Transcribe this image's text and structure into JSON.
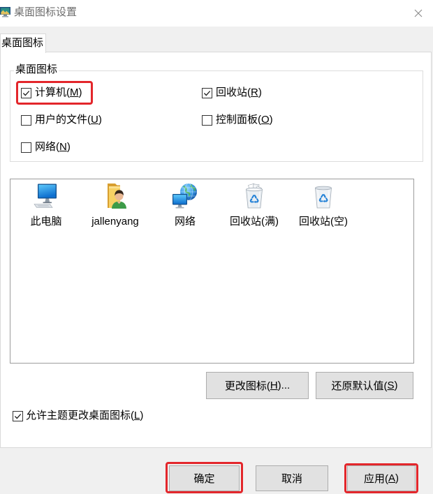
{
  "window": {
    "title": "桌面图标设置",
    "app_icon": "desktop-icon-settings-icon",
    "close_icon": "close-icon"
  },
  "tabs": [
    {
      "label": "桌面图标",
      "active": true
    }
  ],
  "desktop_icons_group": {
    "label": "桌面图标",
    "options": [
      {
        "label": "计算机(M)",
        "checked": true,
        "highlighted": true
      },
      {
        "label": "回收站(R)",
        "checked": true,
        "highlighted": false
      },
      {
        "label": "用户的文件(U)",
        "checked": false,
        "highlighted": false
      },
      {
        "label": "控制面板(O)",
        "checked": false,
        "highlighted": false
      },
      {
        "label": "网络(N)",
        "checked": false,
        "highlighted": false
      }
    ]
  },
  "icon_list": {
    "items": [
      {
        "label": "此电脑",
        "icon": "this-pc-icon"
      },
      {
        "label": "jallenyang",
        "icon": "user-folder-icon"
      },
      {
        "label": "网络",
        "icon": "network-icon"
      },
      {
        "label": "回收站(满)",
        "icon": "recycle-bin-full-icon"
      },
      {
        "label": "回收站(空)",
        "icon": "recycle-bin-empty-icon"
      }
    ]
  },
  "actions": {
    "change_icon": "更改图标(H)...",
    "restore_default": "还原默认值(S)"
  },
  "allow_themes": {
    "label": "允许主题更改桌面图标(L)",
    "checked": true
  },
  "footer": {
    "ok": {
      "label": "确定",
      "highlighted": true
    },
    "cancel": {
      "label": "取消",
      "highlighted": false
    },
    "apply": {
      "label": "应用(A)",
      "highlighted": true
    }
  },
  "colors": {
    "highlight": "#e3262b",
    "dialog_bg": "#f0f0f0",
    "button_bg": "#e1e1e1"
  }
}
